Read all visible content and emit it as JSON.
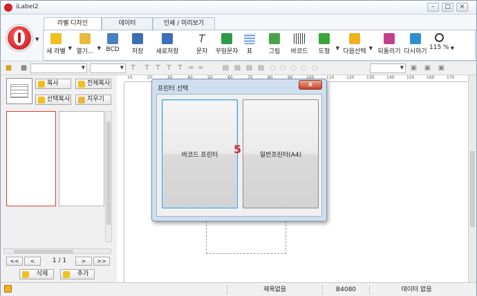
{
  "window": {
    "title": "iLabel2",
    "min": "–",
    "max": "□",
    "close": "×"
  },
  "tabs": [
    {
      "label": "라벨 디자인",
      "active": true
    },
    {
      "label": "데이터",
      "active": false
    },
    {
      "label": "인쇄 / 미리보기",
      "active": false
    }
  ],
  "toolbar": [
    {
      "label": "새 라벨",
      "icon": "new-label-icon",
      "color": "#f0c020"
    },
    {
      "label": "열기...",
      "icon": "open-folder-icon",
      "color": "#e8b93a"
    },
    {
      "label": "BCD",
      "icon": "bcd-icon",
      "color": "#4a7fc1"
    },
    {
      "label": "저장",
      "icon": "save-icon",
      "color": "#3b6fb6"
    },
    {
      "label": "새로저장",
      "icon": "save-as-icon",
      "color": "#3b6fb6"
    },
    {
      "label": "문자",
      "icon": "text-icon",
      "color": "#444444"
    },
    {
      "label": "꾸밈문자",
      "icon": "styled-text-icon",
      "color": "#2e9a4a"
    },
    {
      "label": "표",
      "icon": "table-icon",
      "color": "#3a7bd5"
    },
    {
      "label": "그림",
      "icon": "image-icon",
      "color": "#4aa34a"
    },
    {
      "label": "바코드",
      "icon": "barcode-icon",
      "color": "#333333"
    },
    {
      "label": "도형",
      "icon": "shape-icon",
      "color": "#3aa53a"
    },
    {
      "label": "다음선택",
      "icon": "next-select-icon",
      "color": "#f0b020"
    },
    {
      "label": "되돌리기",
      "icon": "undo-icon",
      "color": "#c2408a"
    },
    {
      "label": "다시하기",
      "icon": "redo-icon",
      "color": "#2d8fd0"
    },
    {
      "label": "115 %",
      "icon": "zoom-icon",
      "color": "#333333"
    }
  ],
  "panel": {
    "copy": "복사",
    "copy_all": "전체복사",
    "copy_selected": "선택복사",
    "erase": "지우기",
    "page_indicator": "1 / 1",
    "first": "<<",
    "prev": "<",
    "next": ">",
    "last": ">>",
    "delete": "삭제",
    "add": "추가"
  },
  "ruler": {
    "ticks": [
      "10",
      "20",
      "30",
      "40",
      "50",
      "60",
      "70",
      "80",
      "90",
      "100",
      "110",
      "120",
      "130",
      "140",
      "150",
      "160",
      "170"
    ]
  },
  "dialog": {
    "title": "프린터 선택",
    "close": "x",
    "option_barcode": "바코드 프린터",
    "option_a4": "일반프린터(A4)"
  },
  "step_number": "5",
  "status": {
    "no_title": "제목없음",
    "code": "B4080",
    "no_data": "데이터 없음"
  }
}
